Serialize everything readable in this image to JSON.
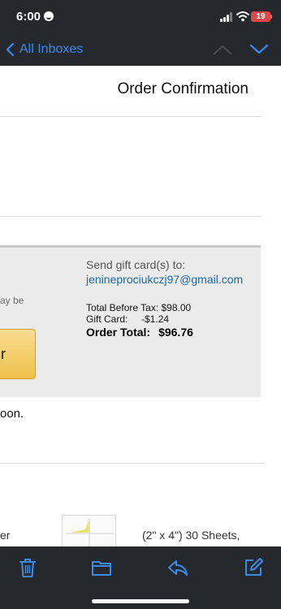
{
  "status_bar": {
    "time": "6:00",
    "battery": "19"
  },
  "nav": {
    "back_label": "All Inboxes"
  },
  "email": {
    "subject": "Order Confirmation",
    "partial_left_text": "ay be",
    "partial_button_label": "r",
    "send_label": "Send gift card(s) to:",
    "recipient_email": "jenineprociukczj97@gmail.com",
    "total_before_tax": "Total Before Tax: $98.00",
    "gift_card": "Gift Card:     -$1.24",
    "order_total_label": "Order Total:",
    "order_total_value": "$96.76",
    "partial_trailing_text": "oon.",
    "partial_item_left": "er",
    "item_description": "(2\" x 4\") 30 Sheets,"
  },
  "toolbar": {
    "icons": [
      "trash-icon",
      "folder-icon",
      "reply-icon",
      "compose-icon"
    ]
  },
  "colors": {
    "accent": "#3b8bea",
    "bar_bg": "#25282d",
    "link": "#1a6aa3"
  }
}
